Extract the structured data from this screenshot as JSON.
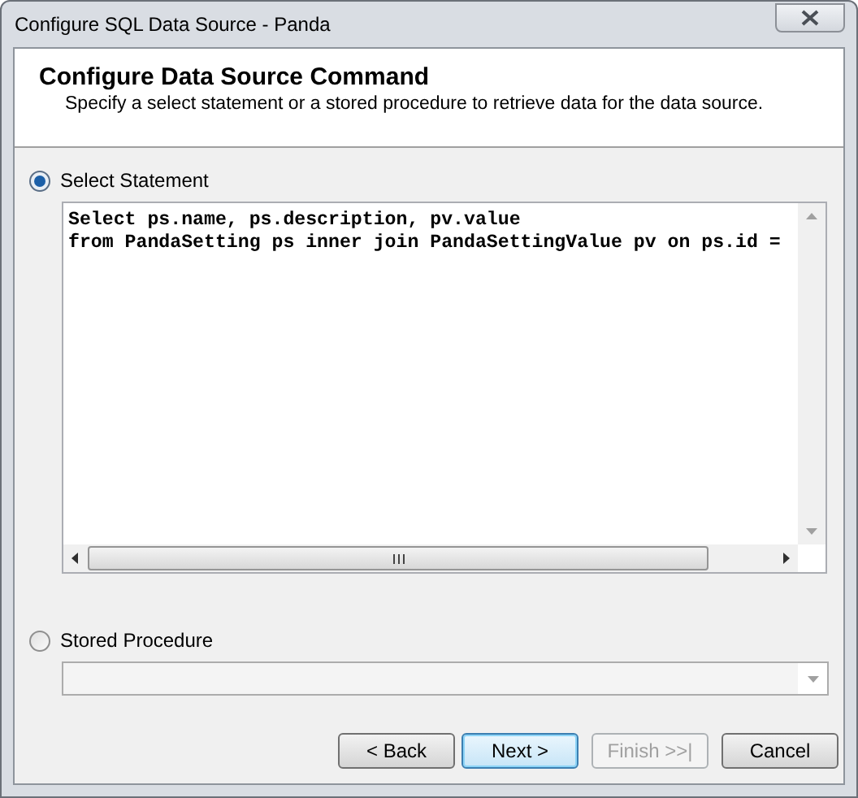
{
  "window": {
    "title": "Configure SQL Data Source - Panda"
  },
  "header": {
    "title": "Configure Data Source Command",
    "subtitle": "Specify a select statement or a stored procedure to retrieve data for the data source."
  },
  "options": [
    {
      "kind": "statement",
      "label": "Select Statement",
      "selected": true,
      "lines": [
        "Select ps.name, ps.description, pv.value",
        "from PandaSetting ps inner join PandaSettingValue pv on ps.id ="
      ]
    },
    {
      "kind": "procedure",
      "label": "Stored Procedure",
      "selected": false
    }
  ],
  "buttons": [
    {
      "label": "< Back",
      "disabled": false,
      "default": false
    },
    {
      "label": "Next >",
      "disabled": false,
      "default": true
    },
    {
      "label": "Finish >>|",
      "disabled": true,
      "default": false
    },
    {
      "label": "Cancel",
      "disabled": false,
      "default": false
    }
  ]
}
